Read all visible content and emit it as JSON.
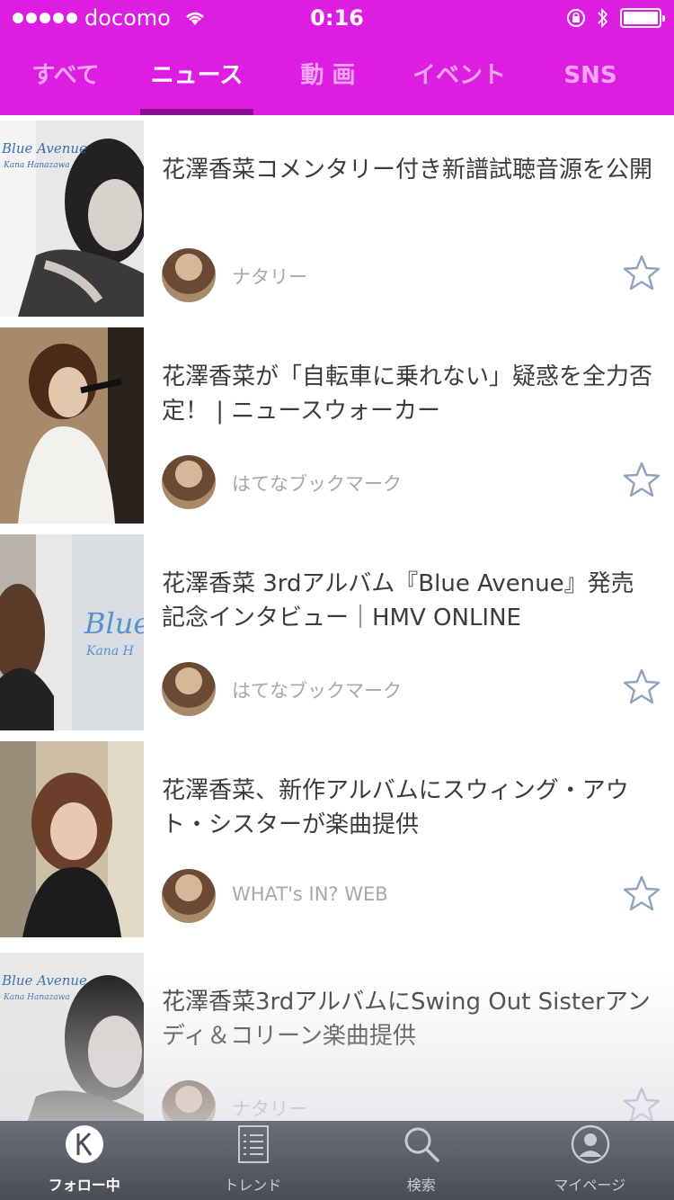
{
  "status_bar": {
    "carrier": "docomo",
    "time": "0:16"
  },
  "tabs": [
    {
      "label": "すべて"
    },
    {
      "label": "ニュース"
    },
    {
      "label": "動 画"
    },
    {
      "label": "イベント"
    },
    {
      "label": "SNS"
    }
  ],
  "active_tab": "ニュース",
  "articles": [
    {
      "title": "花澤香菜コメンタリー付き新譜試聴音源を公開",
      "source": "ナタリー"
    },
    {
      "title": "花澤香菜が「自転車に乗れない」疑惑を全力否定！ | ニュースウォーカー",
      "source": "はてなブックマーク"
    },
    {
      "title": "花澤香菜 3rdアルバム『Blue Avenue』発売記念インタビュー｜HMV ONLINE",
      "source": "はてなブックマーク",
      "thumb_text": "Blue",
      "thumb_subtext": "Kana H"
    },
    {
      "title": "花澤香菜、新作アルバムにスウィング・アウト・シスターが楽曲提供",
      "source": "WHAT's IN? WEB"
    },
    {
      "title": "花澤香菜3rdアルバムにSwing Out Sisterアンディ＆コリーン楽曲提供",
      "source": "ナタリー"
    }
  ],
  "thumb_album_text": "Blue Avenue",
  "thumb_album_sub": "Kana Hanazawa",
  "bottom_nav": [
    {
      "label": "フォロー中",
      "icon": "k-logo-icon"
    },
    {
      "label": "トレンド",
      "icon": "list-icon"
    },
    {
      "label": "検索",
      "icon": "search-icon"
    },
    {
      "label": "マイページ",
      "icon": "profile-icon"
    }
  ],
  "colors": {
    "accent": "#dd1ee2",
    "tab_indicator": "#8a0f90",
    "tabbar": "#55585f"
  }
}
